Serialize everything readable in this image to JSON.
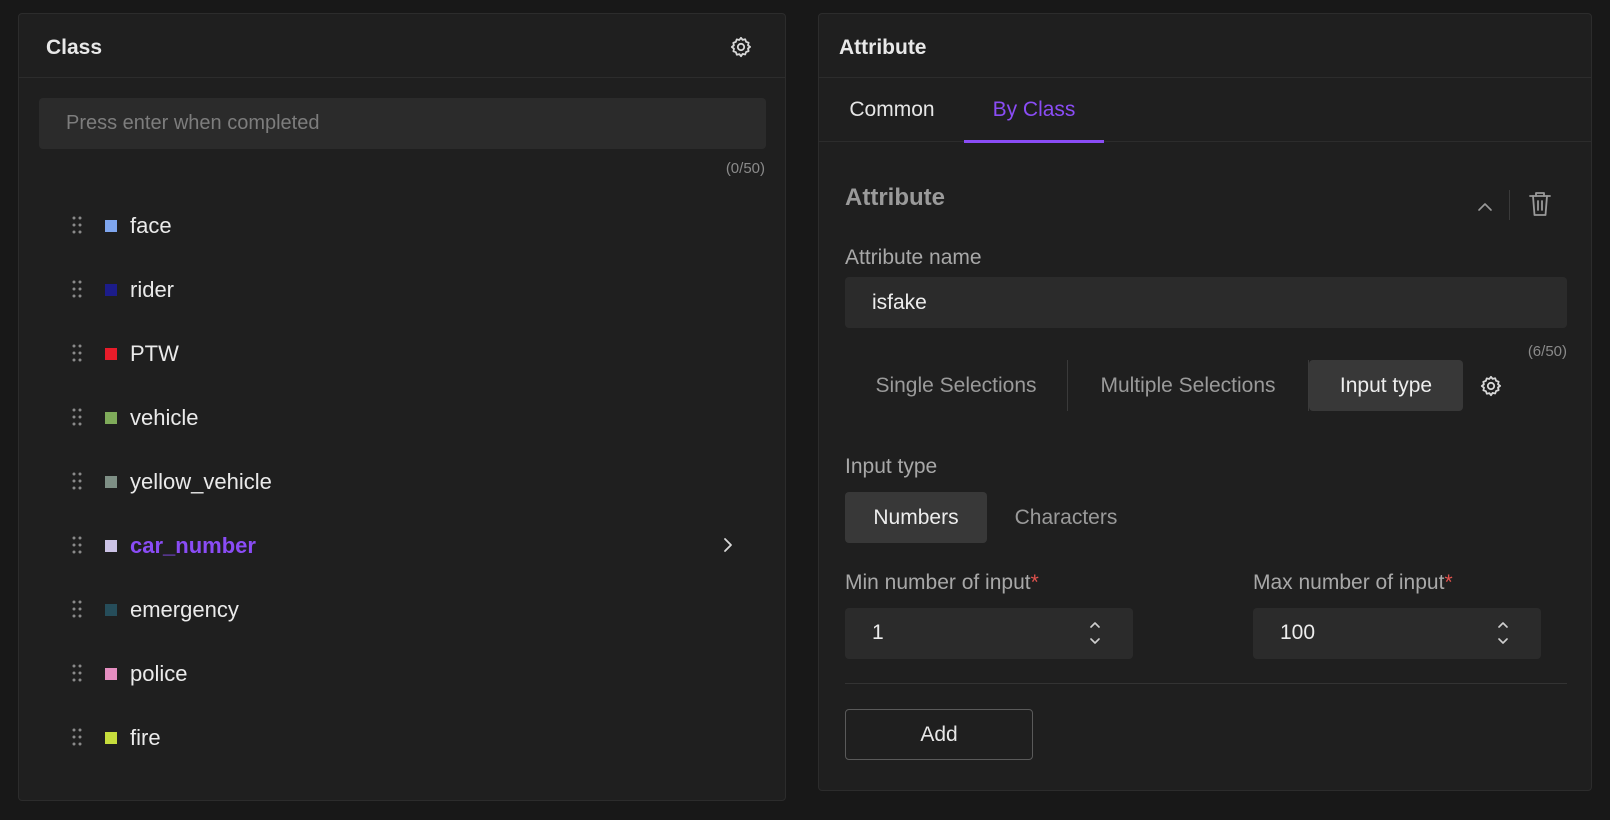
{
  "class_panel": {
    "title": "Class",
    "input_placeholder": "Press enter when completed",
    "counter": "(0/50)",
    "items": [
      {
        "label": "face",
        "color": "#7fa6ee"
      },
      {
        "label": "rider",
        "color": "#1c1c8a"
      },
      {
        "label": "PTW",
        "color": "#e81c2a"
      },
      {
        "label": "vehicle",
        "color": "#7fab5a"
      },
      {
        "label": "yellow_vehicle",
        "color": "#7e8f85"
      },
      {
        "label": "car_number",
        "color": "#ccc3e6",
        "active": true
      },
      {
        "label": "emergency",
        "color": "#264d5a"
      },
      {
        "label": "police",
        "color": "#e58ec0"
      },
      {
        "label": "fire",
        "color": "#c6dd3c"
      }
    ]
  },
  "attribute_panel": {
    "title": "Attribute",
    "tabs": {
      "common": "Common",
      "by_class": "By Class"
    },
    "active_tab": "By Class",
    "section_title": "Attribute",
    "attr_name_label": "Attribute name",
    "attr_name_value": "isfake",
    "attr_name_counter": "(6/50)",
    "selection_types": {
      "single": "Single Selections",
      "multiple": "Multiple Selections",
      "input": "Input type"
    },
    "active_selection": "Input type",
    "input_type_label": "Input type",
    "input_types": {
      "numbers": "Numbers",
      "characters": "Characters"
    },
    "active_input_type": "Numbers",
    "min_label": "Min number of input",
    "max_label": "Max number of input",
    "required_mark": "*",
    "min_value": "1",
    "max_value": "100",
    "add_label": "Add"
  },
  "colors": {
    "accent": "#8a4cf5",
    "background": "#181818",
    "panel": "#1f1f1f",
    "required": "#e0524d"
  }
}
